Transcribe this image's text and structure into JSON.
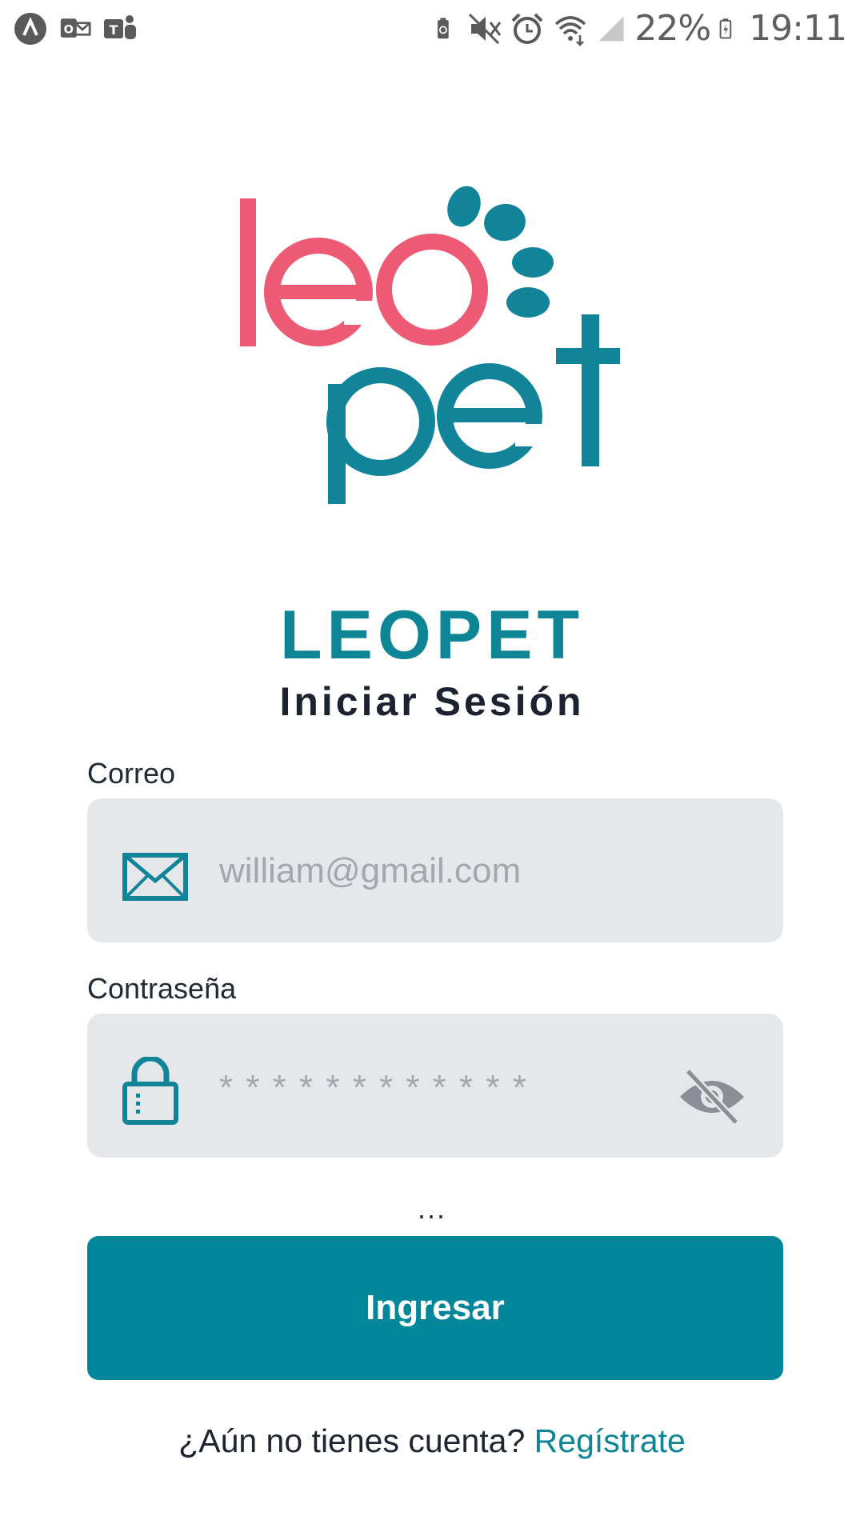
{
  "status_bar": {
    "battery_percent": "22%",
    "time": "19:11",
    "left_icons": [
      "android-auto-icon",
      "outlook-icon",
      "teams-icon"
    ],
    "right_icons": [
      "battery-saver-icon",
      "mute-icon",
      "alarm-icon",
      "wifi-icon",
      "signal-icon",
      "battery-icon"
    ]
  },
  "logo": {
    "text_top": "leo",
    "text_bottom": "pet",
    "colors": {
      "pink": "#ec5a73",
      "teal": "#12849a"
    }
  },
  "app": {
    "title": "LEOPET",
    "subtitle": "Iniciar Sesión"
  },
  "form": {
    "email": {
      "label": "Correo",
      "placeholder": "william@gmail.com",
      "icon": "envelope-icon"
    },
    "password": {
      "label": "Contraseña",
      "placeholder": "* * * * * * * * * * * *",
      "icon": "lock-icon",
      "toggle_icon": "eye-off-icon"
    },
    "status_text": "...",
    "submit_label": "Ingresar"
  },
  "register": {
    "prompt": "¿Aún no tienes cuenta?",
    "link_label": "Regístrate"
  },
  "colors": {
    "accent": "#02879a",
    "input_bg": "#e5e7eb",
    "text_dark": "#1c2230"
  }
}
